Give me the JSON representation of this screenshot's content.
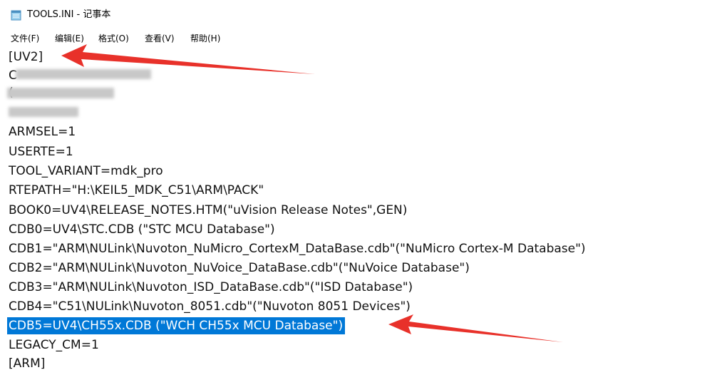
{
  "window": {
    "title": "TOOLS.INI - 记事本",
    "icon": "notepad-icon"
  },
  "menu": [
    {
      "label": "文件(F)"
    },
    {
      "label": "编辑(E)"
    },
    {
      "label": "格式(O)"
    },
    {
      "label": "查看(V)"
    },
    {
      "label": "帮助(H)"
    }
  ],
  "editor": {
    "lines": [
      {
        "text": "[UV2]"
      },
      {
        "text": "C"
      },
      {
        "text": "("
      },
      {
        "text": ""
      },
      {
        "text": "ARMSEL=1"
      },
      {
        "text": "USERTE=1"
      },
      {
        "text": "TOOL_VARIANT=mdk_pro"
      },
      {
        "text": "RTEPATH=\"H:\\KEIL5_MDK_C51\\ARM\\PACK\""
      },
      {
        "text": "BOOK0=UV4\\RELEASE_NOTES.HTM(\"uVision Release Notes\",GEN)"
      },
      {
        "text": "CDB0=UV4\\STC.CDB (\"STC MCU Database\")"
      },
      {
        "text": "CDB1=\"ARM\\NULink\\Nuvoton_NuMicro_CortexM_DataBase.cdb\"(\"NuMicro Cortex-M Database\")"
      },
      {
        "text": "CDB2=\"ARM\\NULink\\Nuvoton_NuVoice_DataBase.cdb\"(\"NuVoice Database\")"
      },
      {
        "text": "CDB3=\"ARM\\NULink\\Nuvoton_ISD_DataBase.cdb\"(\"ISD Database\")"
      },
      {
        "text": "CDB4=\"C51\\NULink\\Nuvoton_8051.cdb\"(\"Nuvoton 8051 Devices\")"
      },
      {
        "text": "CDB5=UV4\\CH55x.CDB (\"WCH CH55x MCU Database\")"
      },
      {
        "text": "LEGACY_CM=1"
      },
      {
        "text": "[ARM]"
      }
    ],
    "selection_color": "#0078d7"
  },
  "annotation": {
    "arrow_color": "#e8312a"
  }
}
